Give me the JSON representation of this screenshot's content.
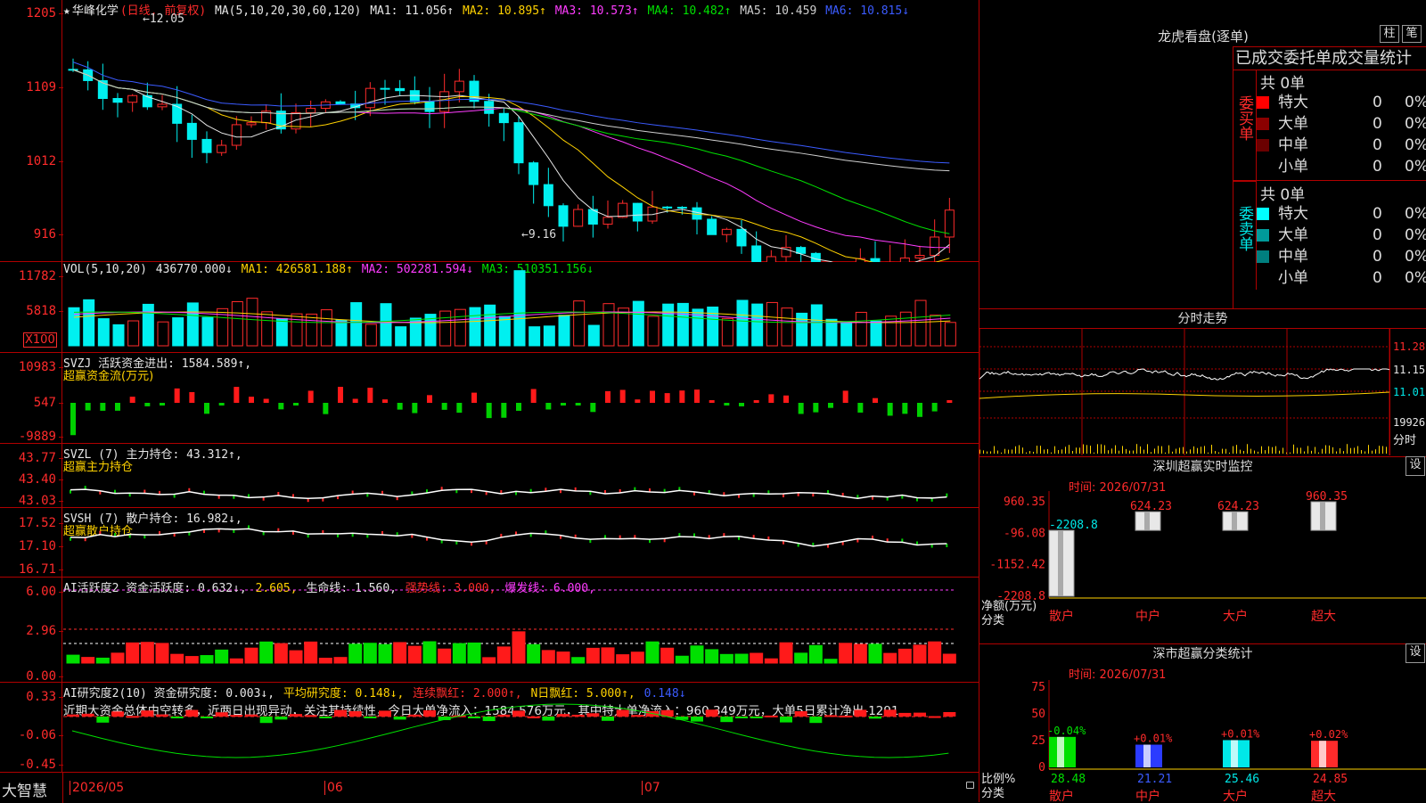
{
  "stock": {
    "star": "★",
    "name": "华峰化学",
    "mode": "(日线, 前复权)"
  },
  "kline": {
    "ticks": [
      "1205",
      "1109",
      "1012",
      "916"
    ],
    "ma_label": "MA(5,10,20,30,60,120)",
    "ma": [
      {
        "k": "MA1:",
        "v": "11.056↑",
        "c": "#e6e6e6"
      },
      {
        "k": "MA2:",
        "v": "10.895↑",
        "c": "#ffd200"
      },
      {
        "k": "MA3:",
        "v": "10.573↑",
        "c": "#ff3cff"
      },
      {
        "k": "MA4:",
        "v": "10.482↑",
        "c": "#00e000"
      },
      {
        "k": "MA5:",
        "v": "10.459",
        "c": "#cfcfcf"
      },
      {
        "k": "MA6:",
        "v": "10.815↓",
        "c": "#3b5bff"
      }
    ],
    "high_label": "←12.05",
    "low_label": "←9.16"
  },
  "volume": {
    "ticks": [
      "11782",
      "5818"
    ],
    "unit": "X100",
    "title": "VOL(5,10,20)",
    "value": "436770.000↓",
    "ma": [
      {
        "k": "MA1:",
        "v": "426581.188↑",
        "c": "#ffd200"
      },
      {
        "k": "MA2:",
        "v": "502281.594↓",
        "c": "#ff3cff"
      },
      {
        "k": "MA3:",
        "v": "510351.156↓",
        "c": "#00e000"
      }
    ]
  },
  "svzj": {
    "ticks": [
      "10983",
      "547",
      "-9889"
    ],
    "title": "SVZJ  活跃资金进出: 1584.589↑,",
    "sub": "超赢资金流(万元)"
  },
  "svzl": {
    "ticks": [
      "43.77",
      "43.40",
      "43.03"
    ],
    "title": "SVZL (7) 主力持仓: 43.312↑,",
    "sub": "超赢主力持仓"
  },
  "svsh": {
    "ticks": [
      "17.52",
      "17.10",
      "16.71"
    ],
    "title": "SVSH (7) 散户持仓: 16.982↓,",
    "sub": "超赢散户持仓"
  },
  "ai_active": {
    "ticks": [
      "6.00",
      "2.96",
      "0.00"
    ],
    "t1": "AI活跃度2 资金活跃度: 0.632↓,",
    "t2": "2.605,",
    "t3": "生命线: 1.560,",
    "t4": "强势线: 3.000,",
    "t5": "爆发线: 6.000,"
  },
  "ai_research": {
    "ticks": [
      "0.33",
      "-0.06",
      "-0.45"
    ],
    "t1": "AI研究度2(10) 资金研究度: 0.003↓,",
    "t2": "平均研究度: 0.148↓,",
    "t3": "连续飘红: 2.000↑,",
    "t4": "N日飘红: 5.000↑,",
    "t5": "0.148↓",
    "summary": "近期大资金总体由空转多，近两日出现异动，关注其持续性，今日大单净流入：1584.576万元，其中特大单净流入：960.349万元，大单5日累计净出-1291."
  },
  "bottom": {
    "brand": "大智慧",
    "dates": [
      "2026/05",
      "06",
      "07"
    ]
  },
  "lhb": {
    "title": "龙虎看盘(逐单)",
    "btn1": "柱",
    "btn2": "笔",
    "subtitle": "已成交委托单成交量统计",
    "buy_label": "委买单",
    "sell_label": "委卖单",
    "buy_total": "共 0单",
    "sell_total": "共 0单",
    "buy_rows": [
      {
        "label": "特大",
        "v1": "0",
        "v2": "0%",
        "color": "#ff0000"
      },
      {
        "label": "大单",
        "v1": "0",
        "v2": "0%",
        "color": "#8b0000"
      },
      {
        "label": "中单",
        "v1": "0",
        "v2": "0%",
        "color": "#6b0000"
      },
      {
        "label": "小单",
        "v1": "0",
        "v2": "0%",
        "color": "#000000"
      }
    ],
    "sell_rows": [
      {
        "label": "特大",
        "v1": "0",
        "v2": "0%",
        "color": "#00ffff"
      },
      {
        "label": "大单",
        "v1": "0",
        "v2": "0%",
        "color": "#009a9a"
      },
      {
        "label": "中单",
        "v1": "0",
        "v2": "0%",
        "color": "#007f7f"
      },
      {
        "label": "小单",
        "v1": "0",
        "v2": "0%",
        "color": "#000000"
      }
    ]
  },
  "intraday": {
    "title": "分时走势",
    "ticks": [
      "11.28",
      "11.15",
      "11.01"
    ],
    "vol": "19926",
    "time_label": "分时"
  },
  "monitor": {
    "title": "深圳超赢实时监控",
    "btn": "设",
    "time": "时间: 2026/07/31",
    "ticks": [
      "960.35",
      "-96.08",
      "-1152.42",
      "-2208.8"
    ],
    "bars": [
      {
        "cat": "散户",
        "val": "-2208.8",
        "v": -2208.8
      },
      {
        "cat": "中户",
        "val": "624.23",
        "v": 624.23
      },
      {
        "cat": "大户",
        "val": "624.23",
        "v": 624.23
      },
      {
        "cat": "超大",
        "val": "960.35",
        "v": 960.35
      }
    ],
    "ylabel": "净额(万元)",
    "xlabel": "分类"
  },
  "classify": {
    "title": "深市超赢分类统计",
    "btn": "设",
    "time": "时间: 2026/07/31",
    "ticks": [
      "75",
      "50",
      "25",
      "0"
    ],
    "bars": [
      {
        "cat": "散户",
        "top": "-0.04%",
        "val": "28.48",
        "v": 28.48,
        "color": "#00e000"
      },
      {
        "cat": "中户",
        "top": "+0.01%",
        "val": "21.21",
        "v": 21.21,
        "color": "#2b3bff"
      },
      {
        "cat": "大户",
        "top": "+0.01%",
        "val": "25.46",
        "v": 25.46,
        "color": "#00e8e8"
      },
      {
        "cat": "超大",
        "top": "+0.02%",
        "val": "24.85",
        "v": 24.85,
        "color": "#ff2b2b"
      }
    ],
    "ylabel": "比例%",
    "xlabel": "分类"
  }
}
